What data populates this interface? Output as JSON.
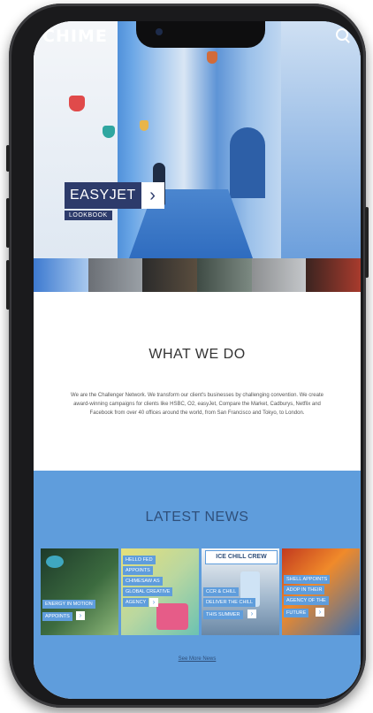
{
  "header": {
    "logo": "CHIME"
  },
  "hero": {
    "title": "EASYJET",
    "arrow": "›",
    "tag": "LOOKBOOK"
  },
  "what_we_do": {
    "title": "WHAT WE DO",
    "body": "We are the Challenger Network. We transform our client's businesses by challenging convention. We create award-winning campaigns for clients like HSBC, O2, easyJet, Compare the Market, Cadburys, Netflix and Facebook from over 40 offices around the world, from San Francisco and Tokyo, to London."
  },
  "news": {
    "title": "LATEST NEWS",
    "cards": [
      {
        "label1": "ENERGY IN MOTION",
        "label2": "APPOINTS",
        "arrow": "›"
      },
      {
        "label1": "HELLO FED",
        "label2": "APPOINTS",
        "label3": "CHIMESAW AS",
        "label4": "GLOBAL CREATIVE",
        "label5": "AGENCY",
        "arrow": "›"
      },
      {
        "label1": "CCR & CHILL",
        "label2": "DELIVER THE CHILL",
        "label3": "THIS SUMMER",
        "arrow": "›"
      },
      {
        "label1": "SHELL APPOINTS",
        "label2": "ADOP IN THEIR",
        "label3": "AGENCY OF THE",
        "label4": "FUTURE",
        "arrow": "›"
      }
    ],
    "card3_sign": "ICE CHILL CREW",
    "see_more": "See More News"
  },
  "colors": {
    "news_bg": "#5f9ddc",
    "promo_bg": "#2d3b6b"
  }
}
